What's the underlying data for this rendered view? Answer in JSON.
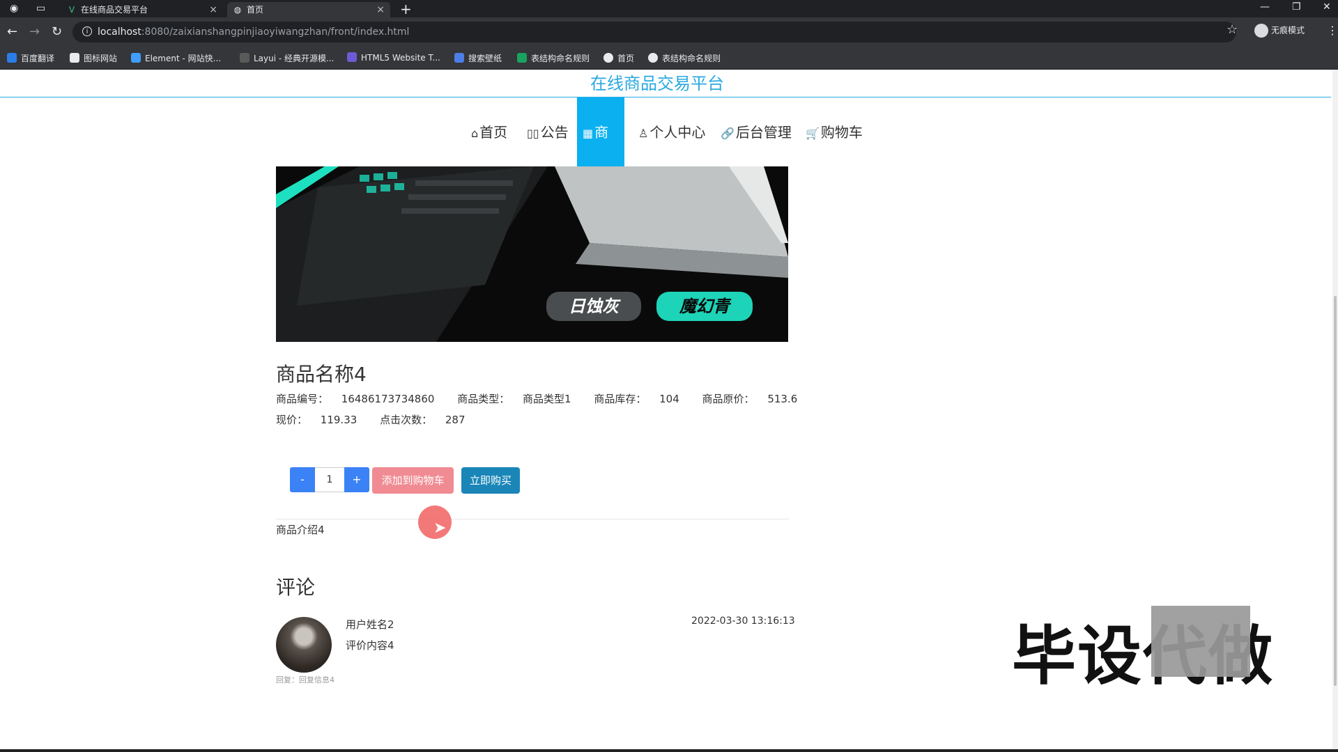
{
  "browser": {
    "tabs": [
      {
        "title": "在线商品交易平台",
        "icon": "vue-icon",
        "close": "×"
      },
      {
        "title": "首页",
        "icon": "globe-icon",
        "close": "×"
      }
    ],
    "new_tab": "+",
    "url_host": "localhost",
    "url_rest": ":8080/zaixianshangpinjiaoyiwangzhan/front/index.html",
    "profile_label": "无痕模式",
    "bookmarks": [
      "百度翻译",
      "图标网站",
      "Element - 网站快...",
      "Layui - 经典开源模...",
      "HTML5 Website T...",
      "搜索壁纸",
      "表结构命名规则",
      "首页",
      "表结构命名规则"
    ]
  },
  "site": {
    "title": "在线商品交易平台",
    "nav": [
      {
        "label": "首页",
        "icon": "home-icon"
      },
      {
        "label": "公告",
        "icon": "notice-icon"
      },
      {
        "label": "商品",
        "icon": "grid-icon"
      },
      {
        "label": "个人中心",
        "icon": "user-icon"
      },
      {
        "label": "后台管理",
        "icon": "link-icon"
      },
      {
        "label": "购物车",
        "icon": "cart-icon"
      }
    ]
  },
  "product": {
    "image_tags": [
      "日蚀灰",
      "魔幻青"
    ],
    "name": "商品名称4",
    "code_label": "商品编号：",
    "code": "16486173734860",
    "type_label": "商品类型：",
    "type": "商品类型1",
    "stock_label": "商品库存：",
    "stock": "104",
    "orig_price_label": "商品原价：",
    "orig_price": "513.6",
    "price_label": "现价：",
    "price": "119.33",
    "clicks_label": "点击次数：",
    "clicks": "287",
    "qty_minus": "-",
    "qty_value": "1",
    "qty_plus": "+",
    "add_to_cart": "添加到购物车",
    "buy_now": "立即购买",
    "description": "商品介绍4"
  },
  "comments": {
    "heading": "评论",
    "items": [
      {
        "user": "用户姓名2",
        "text": "评价内容4",
        "time": "2022-03-30 13:16:13",
        "reply": "回复：回复信息4"
      }
    ]
  },
  "watermark": "毕设代做"
}
